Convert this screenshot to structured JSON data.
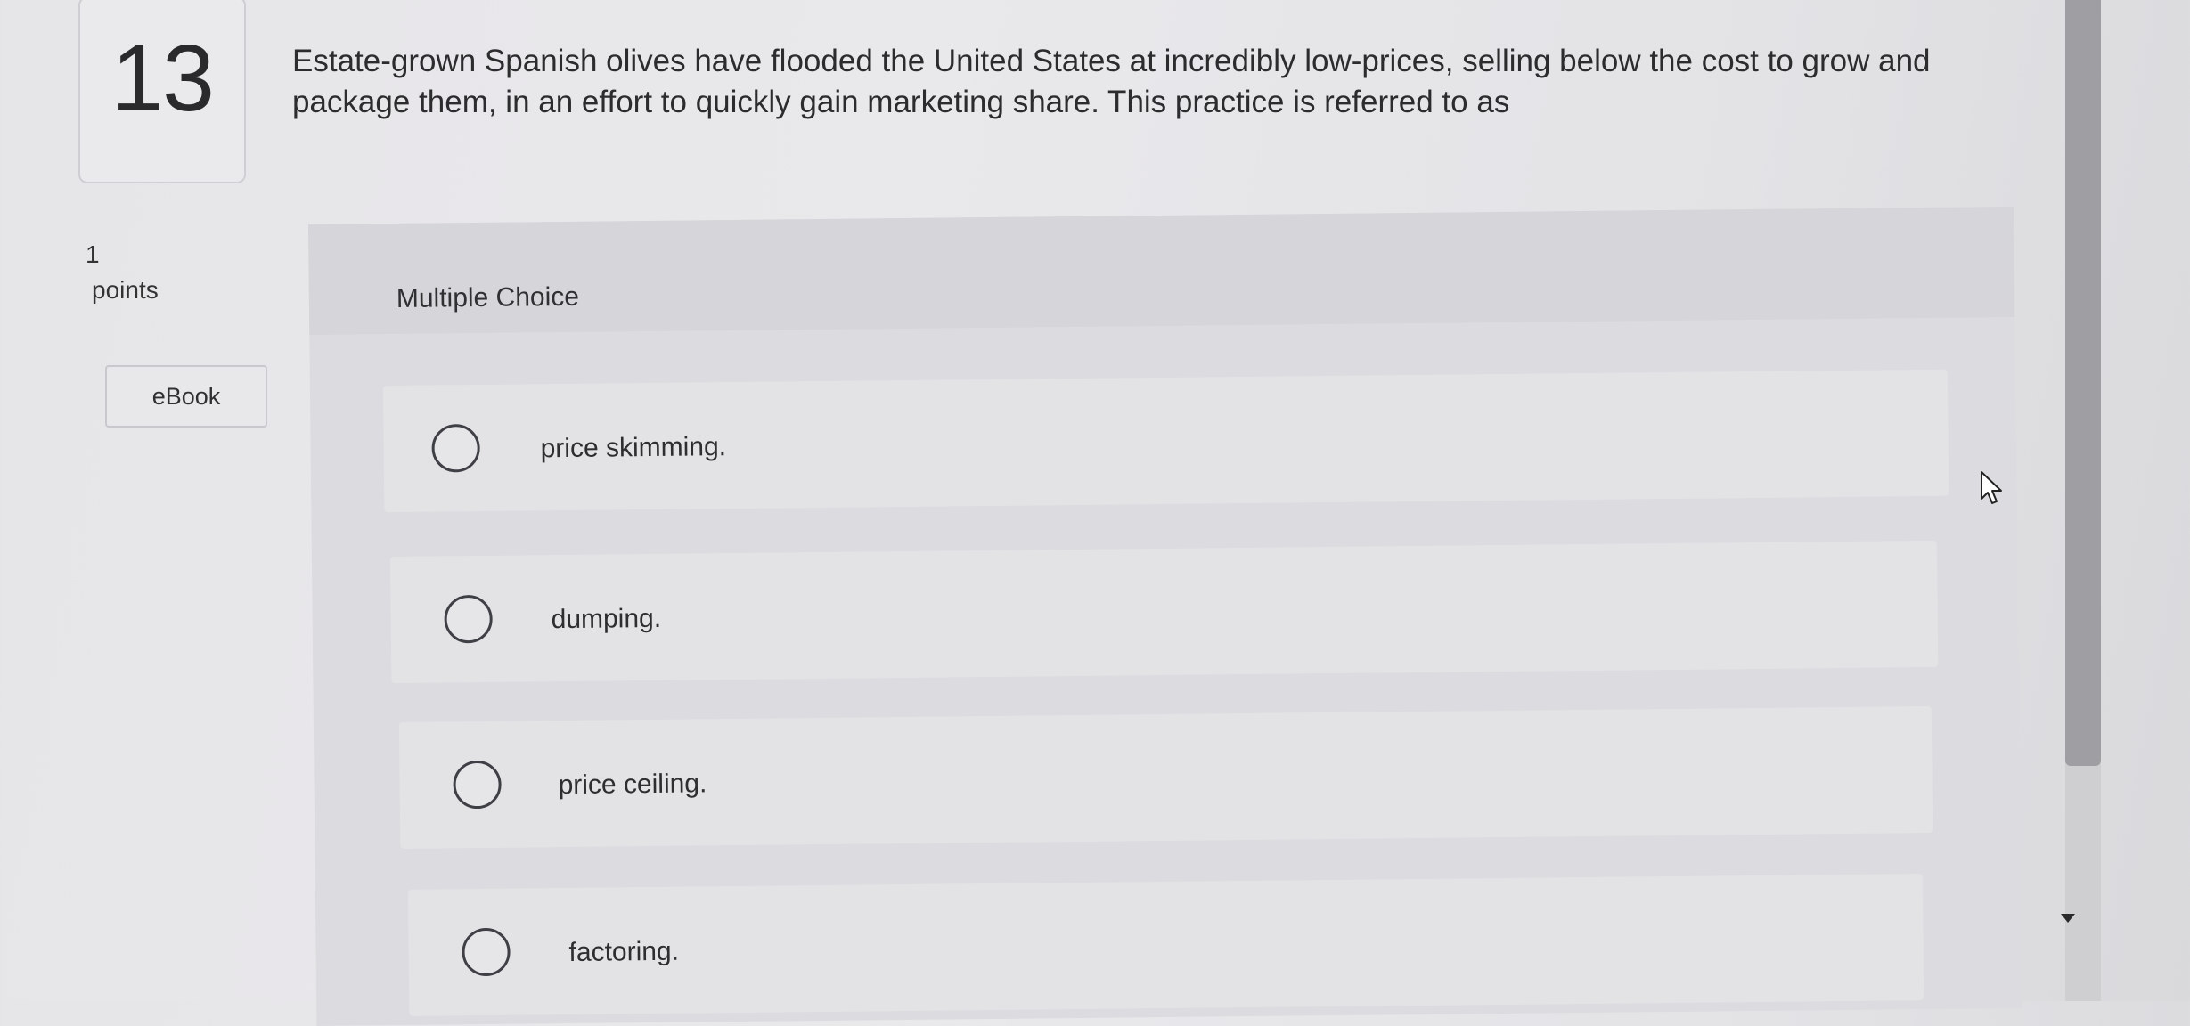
{
  "question": {
    "number": "13",
    "text": "Estate-grown Spanish olives have flooded the United States at incredibly low-prices, selling below the cost to grow and package them, in an effort to quickly gain marketing share. This practice is referred to as",
    "points_value": "1",
    "points_label": "points"
  },
  "ebook": {
    "label": "eBook"
  },
  "multiple_choice": {
    "title": "Multiple Choice",
    "options": [
      {
        "label": "price skimming.",
        "selected": false
      },
      {
        "label": "dumping.",
        "selected": false
      },
      {
        "label": "price ceiling.",
        "selected": false
      },
      {
        "label": "factoring.",
        "selected": false
      }
    ]
  },
  "icons": {
    "cursor": "arrow-pointer-icon",
    "scroll_down": "triangle-down-icon"
  },
  "colors": {
    "background": "#e6e5e8",
    "panel": "#dcdce0",
    "choice_bg": "#e3e3e6",
    "radio_border": "#3f3f46",
    "scroll_thumb": "#9f9fa3"
  }
}
